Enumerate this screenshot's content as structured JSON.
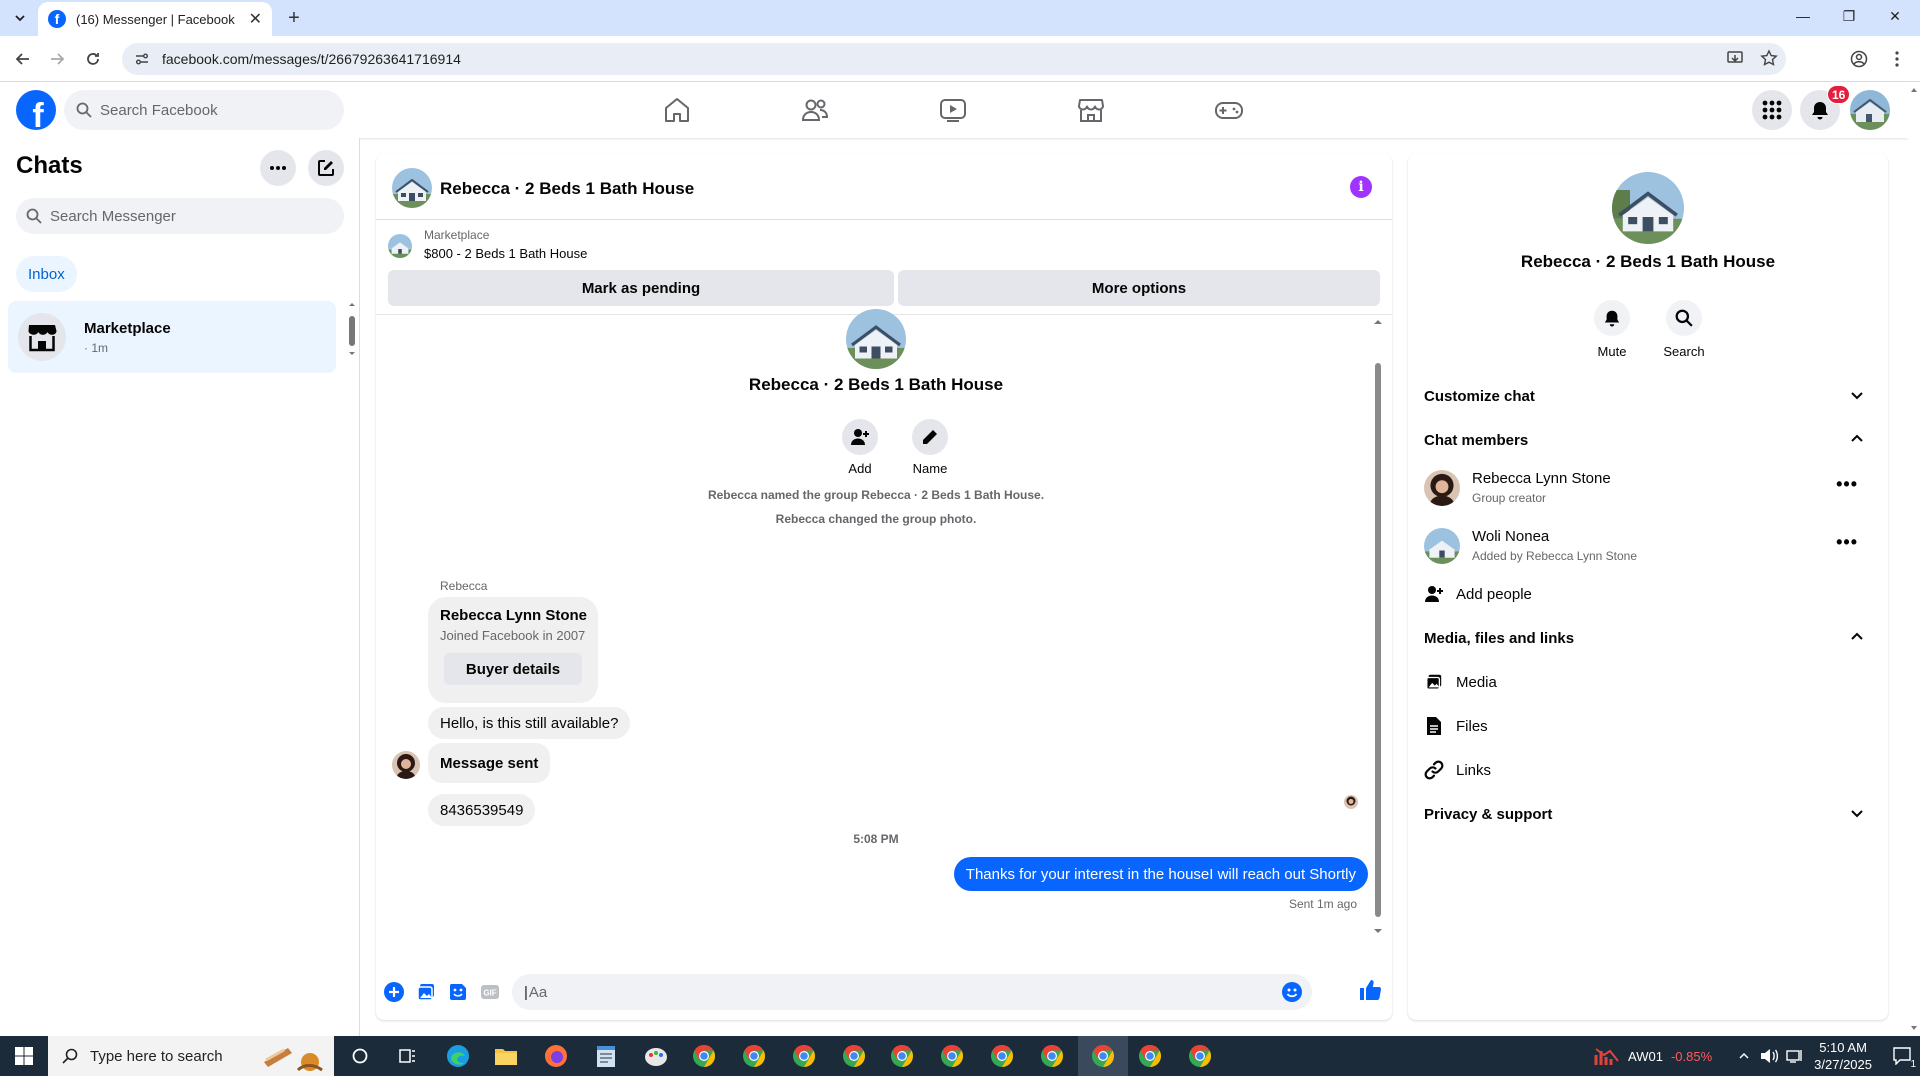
{
  "browser": {
    "tab_title": "(16) Messenger | Facebook",
    "url": "facebook.com/messages/t/26679263641716914"
  },
  "fb_header": {
    "search_placeholder": "Search Facebook",
    "notification_count": "16",
    "nav_icons": [
      "home-icon",
      "friends-icon",
      "video-icon",
      "marketplace-icon",
      "gaming-icon"
    ]
  },
  "sidebar": {
    "title": "Chats",
    "search_placeholder": "Search Messenger",
    "filter_label": "Inbox",
    "chats": [
      {
        "name": "Marketplace",
        "time": "· 1m"
      }
    ]
  },
  "conversation": {
    "title": "Rebecca · 2 Beds 1 Bath House",
    "marketplace_label": "Marketplace",
    "listing": "$800 - 2 Beds 1 Bath House",
    "mark_pending_label": "Mark as pending",
    "more_options_label": "More options",
    "group_name": "Rebecca · 2 Beds 1 Bath House",
    "actions": [
      {
        "label": "Add"
      },
      {
        "label": "Name"
      }
    ],
    "system_messages": [
      "Rebecca named the group Rebecca · 2 Beds 1 Bath House.",
      "Rebecca changed the group photo."
    ],
    "sender_label": "Rebecca",
    "buyer_card": {
      "name": "Rebecca Lynn Stone",
      "joined": "Joined Facebook in 2007",
      "button": "Buyer details"
    },
    "incoming": [
      "Hello, is this still available?",
      "Message sent",
      "8436539549"
    ],
    "timestamp": "5:08 PM",
    "outgoing": "Thanks for your interest in the houseI will reach out Shortly",
    "sent_status": "Sent 1m ago",
    "input_placeholder": "Aa"
  },
  "details": {
    "name": "Rebecca · 2 Beds 1 Bath House",
    "mute_label": "Mute",
    "search_label": "Search",
    "customize_label": "Customize chat",
    "members_label": "Chat members",
    "members": [
      {
        "name": "Rebecca Lynn Stone",
        "sub": "Group creator"
      },
      {
        "name": "Woli Nonea",
        "sub": "Added by Rebecca Lynn Stone"
      }
    ],
    "add_people_label": "Add people",
    "media_section_label": "Media, files and links",
    "media_label": "Media",
    "files_label": "Files",
    "links_label": "Links",
    "privacy_label": "Privacy & support"
  },
  "taskbar": {
    "search_placeholder": "Type here to search",
    "ticker": "AW01",
    "ticker_change": "-0.85%",
    "time": "5:10 AM",
    "date": "3/27/2025",
    "notif_count": "1"
  },
  "colors": {
    "fb_blue": "#0866ff",
    "info_purple": "#a033ff",
    "badge_red": "#e41e3f",
    "taskbar": "#1c2b3a"
  }
}
